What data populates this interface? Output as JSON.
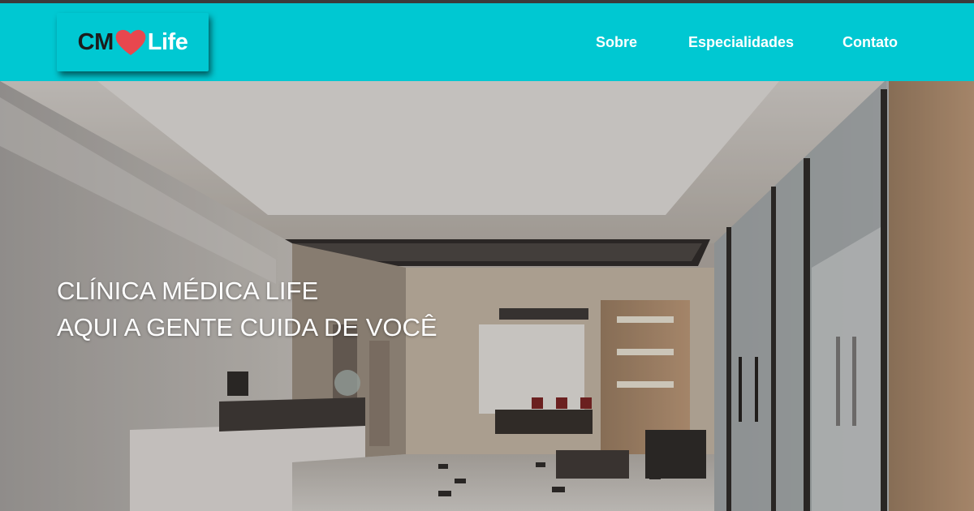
{
  "logo": {
    "prefix": "CM",
    "suffix": "Life",
    "heart_icon": "heart-icon",
    "heart_color": "#e8474e"
  },
  "nav": {
    "items": [
      {
        "label": "Sobre"
      },
      {
        "label": "Especialidades"
      },
      {
        "label": "Contato"
      }
    ]
  },
  "hero": {
    "line1": "CLÍNICA MÉDICA LIFE",
    "line2": "AQUI A GENTE CUIDA DE VOCÊ"
  },
  "colors": {
    "header_bg": "#00c8d2",
    "nav_text": "#ffffff"
  }
}
